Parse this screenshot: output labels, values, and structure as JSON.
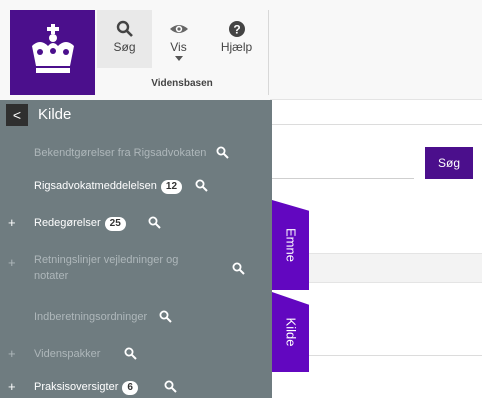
{
  "ribbon": {
    "buttons": [
      {
        "label": "Søg",
        "icon": "search-icon"
      },
      {
        "label": "Vis",
        "icon": "eye-icon"
      },
      {
        "label": "Hjælp",
        "icon": "help-icon"
      }
    ],
    "group_label": "Vidensbasen"
  },
  "panel": {
    "back_glyph": "<",
    "title": "Kilde",
    "items": [
      {
        "label": "Bekendtgørelser fra Rigsadvokaten",
        "badge": "",
        "expand": "",
        "active": false
      },
      {
        "label": "Rigsadvokatmeddelelsen",
        "badge": "12",
        "expand": "",
        "active": true
      },
      {
        "label": "Redegørelser",
        "badge": "25",
        "expand": "+",
        "active": true
      },
      {
        "label": "Retningslinjer vejledninger og notater",
        "badge": "",
        "expand": "+",
        "active": false
      },
      {
        "label": "Indberetningsordninger",
        "badge": "",
        "expand": "",
        "active": false
      },
      {
        "label": "Videnspakker",
        "badge": "",
        "expand": "+",
        "active": false
      },
      {
        "label": "Praksisoversigter",
        "badge": "6",
        "expand": "+",
        "active": true
      }
    ]
  },
  "main": {
    "search_button": "Søg",
    "tabs": [
      "Emne",
      "Kilde"
    ]
  },
  "colors": {
    "brand": "#4b0f8c",
    "tab": "#6207c0",
    "panel": "#6f7c80"
  }
}
